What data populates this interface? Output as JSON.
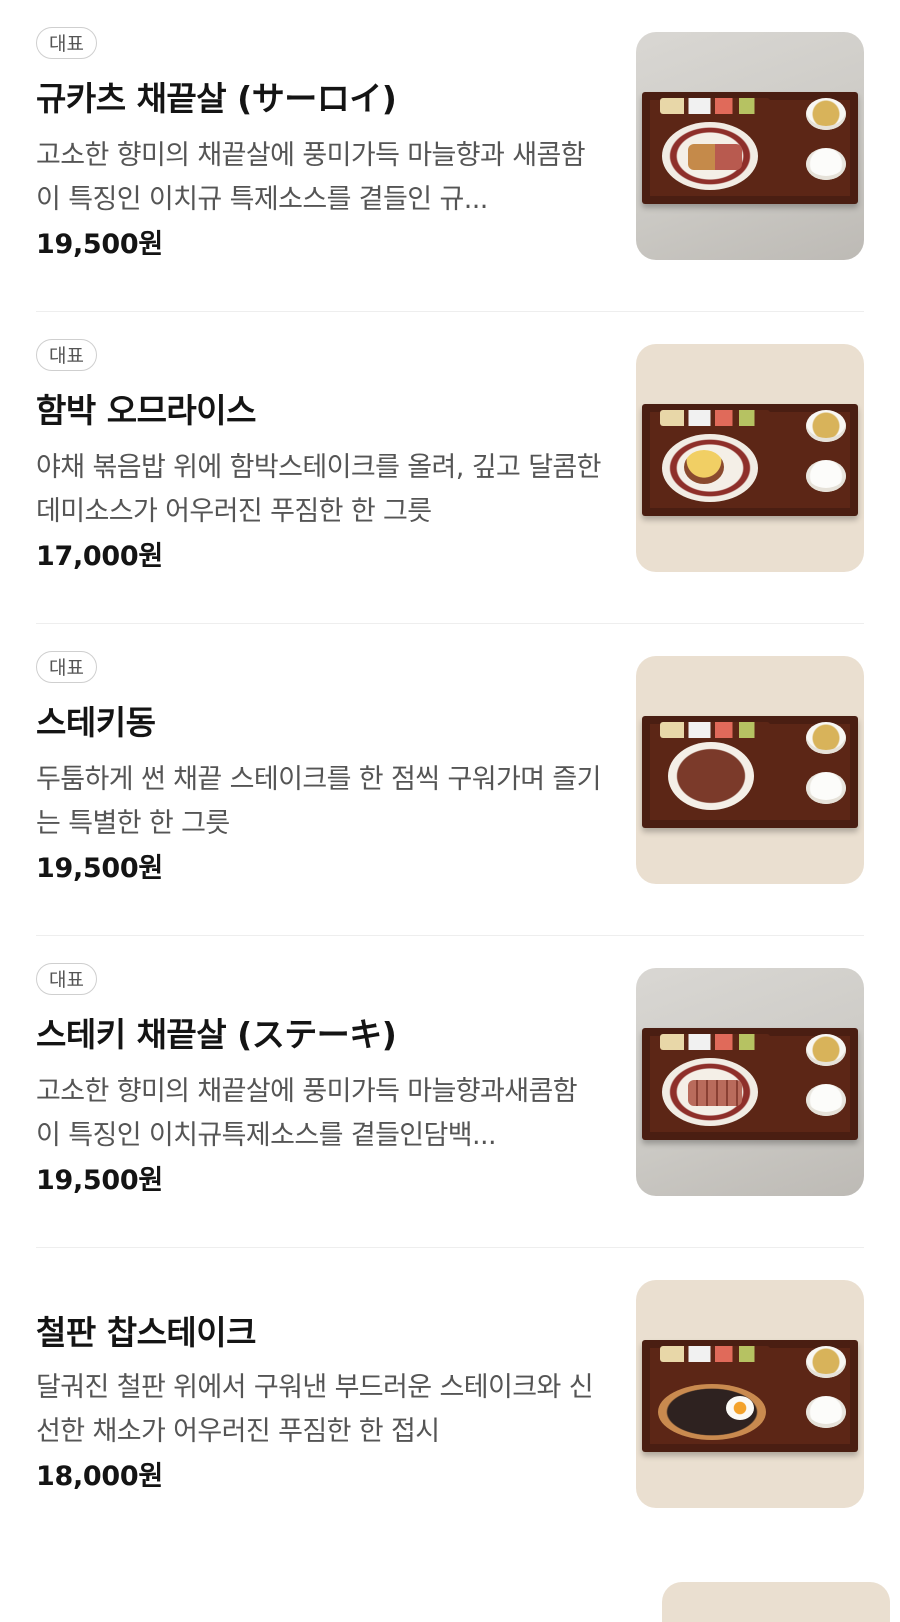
{
  "menu": {
    "items": [
      {
        "badge": "대표",
        "name": "규카츠 채끝살 (サーロイ)",
        "description": "고소한 향미의 채끝살에 풍미가득 마늘향과 새콤함이 특징인 이치규 특제소스를 곁들인 규...",
        "price": "19,500원",
        "image": "gyukatsu-sirloin-set-photo"
      },
      {
        "badge": "대표",
        "name": "함박 오므라이스",
        "description": "야채 볶음밥 위에 함박스테이크를 올려, 깊고 달콤한 데미소스가 어우러진 푸짐한 한 그릇",
        "price": "17,000원",
        "image": "hamburg-omurice-set-photo"
      },
      {
        "badge": "대표",
        "name": "스테키동",
        "description": "두툼하게 썬 채끝 스테이크를 한 점씩 구워가며 즐기는 특별한 한 그릇",
        "price": "19,500원",
        "image": "steak-don-set-photo"
      },
      {
        "badge": "대표",
        "name": "스테키 채끝살 (ステーキ)",
        "description": "고소한 향미의 채끝살에 풍미가득 마늘향과새콤함이 특징인 이치규특제소스를 곁들인담백...",
        "price": "19,500원",
        "image": "steak-sirloin-set-photo"
      },
      {
        "badge": "",
        "name": "철판 찹스테이크",
        "description": "달궈진 철판 위에서 구워낸 부드러운 스테이크와 신선한 채소가 어우러진 푸짐한 한 접시",
        "price": "18,000원",
        "image": "teppan-chop-steak-set-photo"
      }
    ]
  }
}
